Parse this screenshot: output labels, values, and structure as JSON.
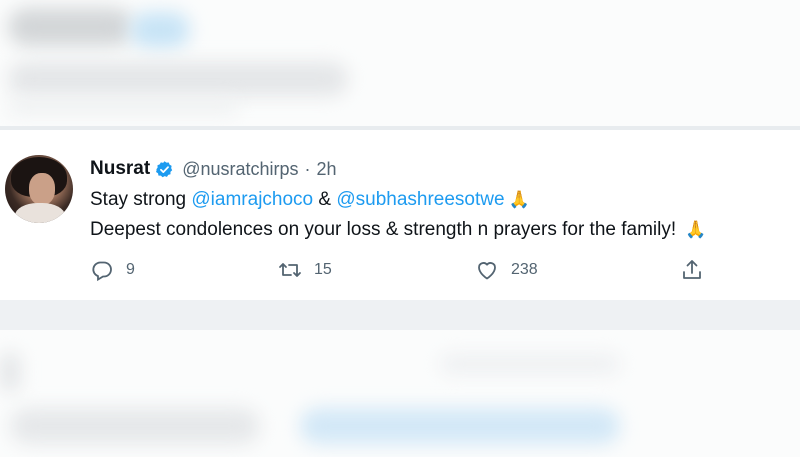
{
  "tweet": {
    "name": "Nusrat",
    "handle": "@nusratchirps",
    "separator": "·",
    "time": "2h",
    "line1": {
      "prefix": "Stay strong ",
      "mention1": "@iamrajchoco",
      "connector": " & ",
      "mention2": "@subhashreesotwe",
      "emoji": "🙏"
    },
    "line2": {
      "text": "Deepest condolences on your loss & strength n prayers for the family! ",
      "emoji": "🙏"
    },
    "actions": {
      "replies": "9",
      "retweets": "15",
      "likes": "238"
    }
  },
  "colors": {
    "accent": "#1d9bf0",
    "text": "#0f1419",
    "muted": "#536471",
    "emoji": "#e7a226"
  },
  "icons": [
    "verified-badge-icon",
    "reply-icon",
    "retweet-icon",
    "like-icon",
    "share-icon"
  ]
}
